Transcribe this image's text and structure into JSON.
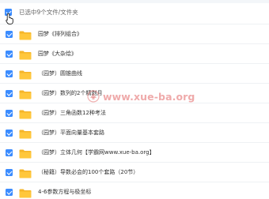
{
  "header": {
    "selection_text": "已选中9个文件/文件夹",
    "select_all_checked": true
  },
  "files": [
    {
      "name": "园梦《排列组合》"
    },
    {
      "name": "园梦《大杂烩》"
    },
    {
      "name": "（园梦）圆锥曲线"
    },
    {
      "name": "（园梦）数列的2个精剥月"
    },
    {
      "name": "（园梦）三角函数12种考法"
    },
    {
      "name": "（园梦）平面向量基本套路"
    },
    {
      "name": "（园梦）立体几何【学霸网www.xue-ba.org】"
    },
    {
      "name": "（秘籍）导数必会的100个套路（20节）"
    },
    {
      "name": "4-6参数方程与极坐标"
    }
  ],
  "watermark": {
    "text": "www.xue-ba.org"
  },
  "colors": {
    "checkbox": "#3b8cff",
    "folder": "#ffc73b",
    "folder_tab": "#f5b52a"
  }
}
